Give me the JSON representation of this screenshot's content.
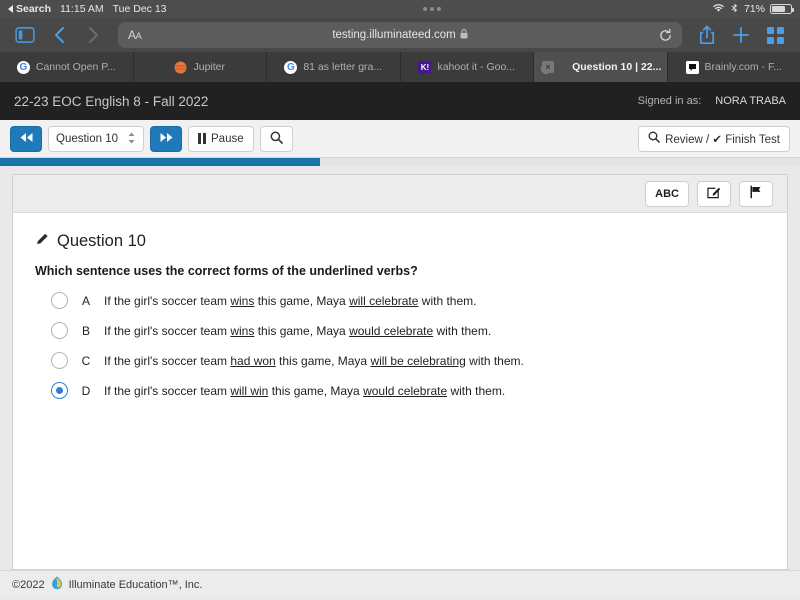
{
  "status_bar": {
    "search_label": "Search",
    "time": "11:15 AM",
    "date": "Tue Dec 13",
    "battery_percent": "71%",
    "wifi_icon": "wifi-icon",
    "bluetooth_icon": "bluetooth-icon",
    "battery_icon": "battery-icon"
  },
  "browser": {
    "sidebar_icon": "sidebar-icon",
    "back_icon": "chevron-left-icon",
    "forward_icon": "chevron-right-icon",
    "reader_label": "AA",
    "url": "testing.illuminateed.com",
    "lock_icon": "lock-icon",
    "reload_icon": "reload-icon",
    "share_icon": "share-icon",
    "new_tab_icon": "plus-icon",
    "tabs_overview_icon": "tabs-grid-icon",
    "tabs": [
      {
        "title": "Cannot Open P...",
        "favicon": "google-icon",
        "active": false,
        "closable": false
      },
      {
        "title": "Jupiter",
        "favicon": "jupiter-icon",
        "active": false,
        "closable": false
      },
      {
        "title": "81 as letter gra...",
        "favicon": "google-icon",
        "active": false,
        "closable": false
      },
      {
        "title": "kahoot it - Goo...",
        "favicon": "kahoot-icon",
        "active": false,
        "closable": false
      },
      {
        "title": "Question 10 | 22...",
        "favicon": "illuminate-icon",
        "active": true,
        "closable": true,
        "close_label": "×"
      },
      {
        "title": "Brainly.com - F...",
        "favicon": "brainly-icon",
        "active": false,
        "closable": false
      }
    ]
  },
  "app": {
    "title": "22-23 EOC English 8 - Fall 2022",
    "signed_in_label": "Signed in as:",
    "user_name": "NORA TRABA",
    "accent_color": "#2079b8",
    "progress_percent": 40
  },
  "toolbar": {
    "prev_icon": "rewind-icon",
    "next_icon": "fast-forward-icon",
    "question_select_value": "Question 10",
    "pause_label": "Pause",
    "pause_icon": "pause-icon",
    "search_icon": "search-icon",
    "review_finish_label": "Review / ✔ Finish Test",
    "review_icon": "magnifier-icon"
  },
  "question_tools": {
    "abc_label": "ABC",
    "notes_icon": "edit-square-icon",
    "flag_icon": "flag-icon"
  },
  "question": {
    "pencil_icon": "pencil-icon",
    "heading": "Question 10",
    "prompt": "Which sentence uses the correct forms of the underlined verbs?",
    "options": [
      {
        "letter": "A",
        "selected": false,
        "parts": [
          {
            "text": "If the girl's soccer team ",
            "underline": false
          },
          {
            "text": "wins",
            "underline": true
          },
          {
            "text": " this game, Maya ",
            "underline": false
          },
          {
            "text": "will celebrate",
            "underline": true
          },
          {
            "text": " with them.",
            "underline": false
          }
        ]
      },
      {
        "letter": "B",
        "selected": false,
        "parts": [
          {
            "text": "If the girl's soccer team ",
            "underline": false
          },
          {
            "text": "wins",
            "underline": true
          },
          {
            "text": " this game, Maya ",
            "underline": false
          },
          {
            "text": "would celebrate",
            "underline": true
          },
          {
            "text": " with them.",
            "underline": false
          }
        ]
      },
      {
        "letter": "C",
        "selected": false,
        "parts": [
          {
            "text": "If the girl's soccer team ",
            "underline": false
          },
          {
            "text": "had won",
            "underline": true
          },
          {
            "text": " this game, Maya ",
            "underline": false
          },
          {
            "text": "will be celebrating",
            "underline": true
          },
          {
            "text": " with them.",
            "underline": false
          }
        ]
      },
      {
        "letter": "D",
        "selected": true,
        "parts": [
          {
            "text": "If the girl's soccer team ",
            "underline": false
          },
          {
            "text": "will win",
            "underline": true
          },
          {
            "text": " this game, Maya ",
            "underline": false
          },
          {
            "text": "would celebrate",
            "underline": true
          },
          {
            "text": " with them.",
            "underline": false
          }
        ]
      }
    ]
  },
  "footer": {
    "copyright": "©2022",
    "logo_icon": "illuminate-logo-icon",
    "company": "Illuminate Education™, Inc."
  }
}
